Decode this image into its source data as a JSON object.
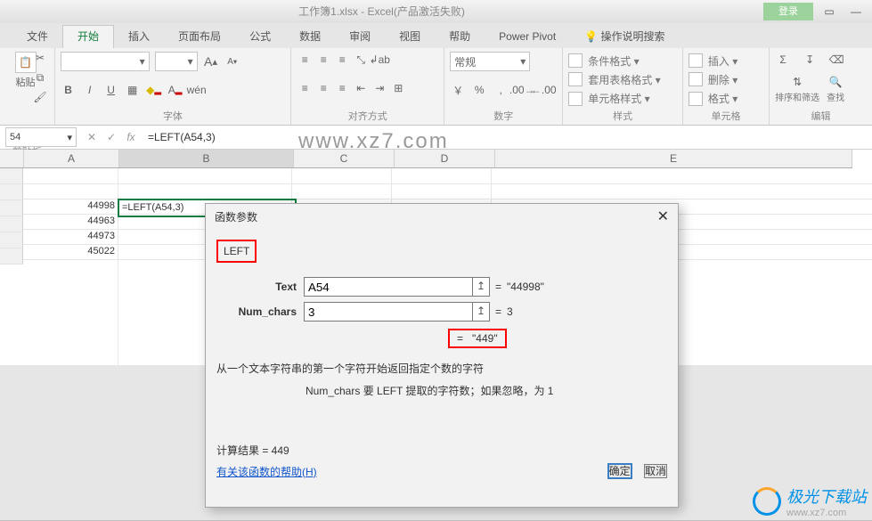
{
  "titlebar": {
    "title": "工作簿1.xlsx  -  Excel(产品激活失败)",
    "login": "登录"
  },
  "tabs": {
    "file": "文件",
    "home": "开始",
    "insert": "插入",
    "page": "页面布局",
    "formula": "公式",
    "data": "数据",
    "review": "审阅",
    "view": "视图",
    "help": "帮助",
    "pivot": "Power Pivot",
    "tell_me": "操作说明搜索"
  },
  "ribbon": {
    "clipboard": {
      "paste_label": "粘贴",
      "group_label": "剪贴板"
    },
    "font": {
      "group_label": "字体",
      "bold": "B",
      "italic": "I",
      "underline": "U"
    },
    "align": {
      "group_label": "对齐方式"
    },
    "number": {
      "group_label": "数字",
      "general": "常规"
    },
    "styles": {
      "cond": "条件格式 ▾",
      "table": "套用表格格式 ▾",
      "cell": "单元格样式 ▾",
      "group_label": "样式"
    },
    "cells": {
      "insert": "插入 ▾",
      "delete": "删除 ▾",
      "format": "格式 ▾",
      "group_label": "单元格"
    },
    "edit": {
      "sort": "排序和筛选",
      "find": "查找",
      "group_label": "编辑"
    }
  },
  "formula_bar": {
    "name_box": "54",
    "fx_label": "fx",
    "formula": "=LEFT(A54,3)"
  },
  "columns": {
    "A": "A",
    "B": "B",
    "C": "C",
    "D": "D",
    "E": "E"
  },
  "sheet": {
    "vals": {
      "a54": "44998",
      "a55": "44963",
      "a56": "44973",
      "a57": "45022"
    },
    "b54": "=LEFT(A54,3)"
  },
  "dialog": {
    "title": "函数参数",
    "func_name": "LEFT",
    "text_label": "Text",
    "text_value": "A54",
    "text_eval": "\"44998\"",
    "num_label": "Num_chars",
    "num_value": "3",
    "num_eval": "3",
    "result_eq": "=",
    "result": "\"449\"",
    "desc": "从一个文本字符串的第一个字符开始返回指定个数的字符",
    "arg_help": "Num_chars  要 LEFT 提取的字符数；如果忽略，为 1",
    "calc_label": "计算结果 =  449",
    "help_link": "有关该函数的帮助(H)",
    "ok": "确定",
    "cancel": "取消"
  },
  "watermark": {
    "main": "www.xz7.com",
    "brand": "极光下载站",
    "site": "www.xz7.com"
  }
}
